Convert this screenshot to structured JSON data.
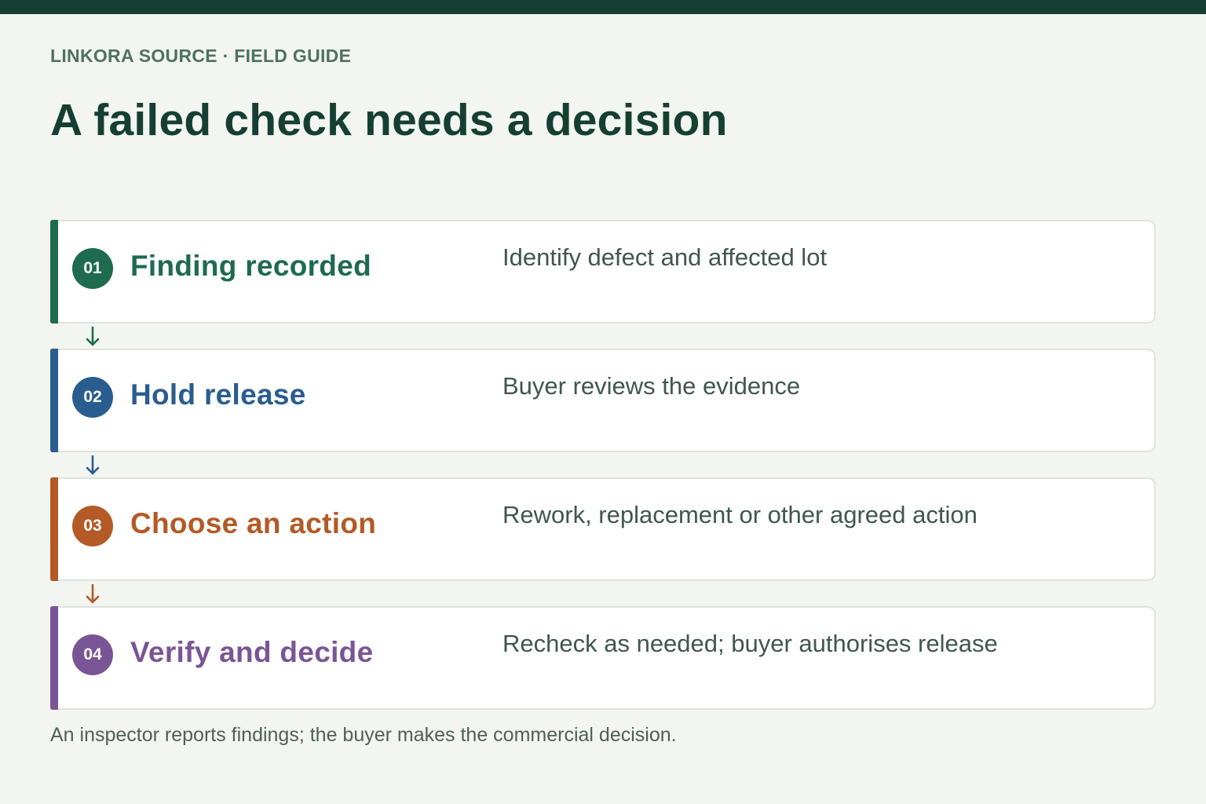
{
  "header": {
    "eyebrow": "LINKORA SOURCE · FIELD GUIDE",
    "title": "A failed check needs a decision"
  },
  "steps": [
    {
      "number": "01",
      "title": "Finding recorded",
      "description": "Identify defect and affected lot",
      "color": "#1e6b4f"
    },
    {
      "number": "02",
      "title": "Hold release",
      "description": "Buyer reviews the evidence",
      "color": "#2a5d8f"
    },
    {
      "number": "03",
      "title": "Choose an action",
      "description": "Rework, replacement or other agreed action",
      "color": "#b35a26"
    },
    {
      "number": "04",
      "title": "Verify and decide",
      "description": "Recheck as needed; buyer authorises release",
      "color": "#7a5595"
    }
  ],
  "connectors": [
    {
      "icon": "arrow-down-icon",
      "color": "#1e6b4f"
    },
    {
      "icon": "arrow-down-icon",
      "color": "#2a5d8f"
    },
    {
      "icon": "arrow-down-icon",
      "color": "#b35a26"
    }
  ],
  "footnote": "An inspector reports findings; the buyer makes the commercial decision.",
  "colors": {
    "topbar": "#163f33",
    "background": "#f3f5f0",
    "title": "#163f33"
  }
}
